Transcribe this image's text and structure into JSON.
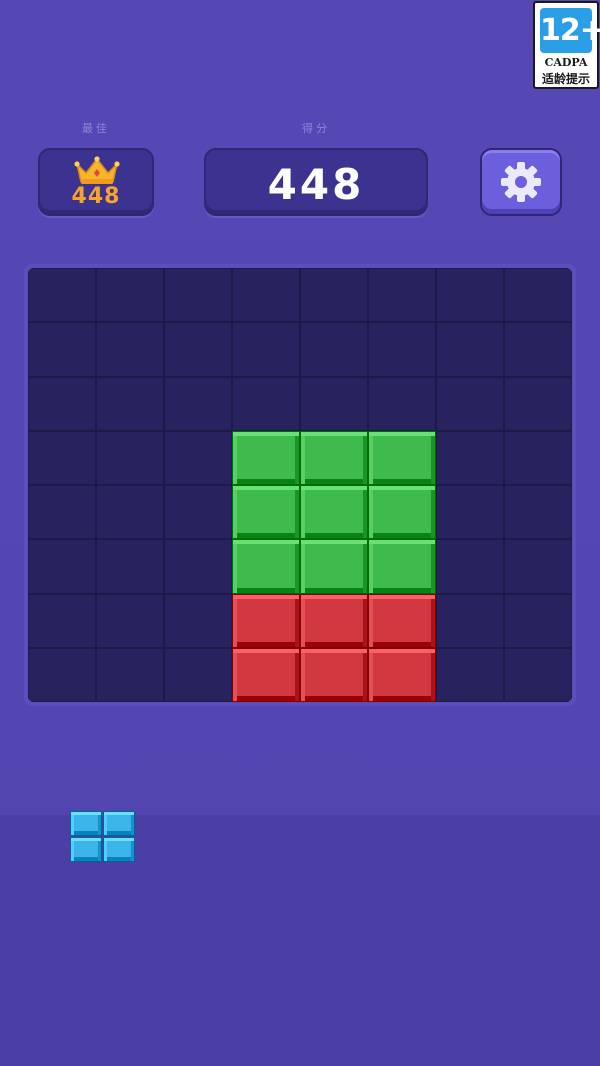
{
  "labels": {
    "best": "最佳",
    "score": "得分"
  },
  "best_score": "448",
  "current_score": "448",
  "age_rating": {
    "age": "12+",
    "org": "CADPA",
    "hint": "适龄提示"
  },
  "board": {
    "cols": 8,
    "rows": 8,
    "filled": [
      {
        "row": 3,
        "col": 3,
        "color": "green"
      },
      {
        "row": 3,
        "col": 4,
        "color": "green"
      },
      {
        "row": 3,
        "col": 5,
        "color": "green"
      },
      {
        "row": 4,
        "col": 3,
        "color": "green"
      },
      {
        "row": 4,
        "col": 4,
        "color": "green"
      },
      {
        "row": 4,
        "col": 5,
        "color": "green"
      },
      {
        "row": 5,
        "col": 3,
        "color": "green"
      },
      {
        "row": 5,
        "col": 4,
        "color": "green"
      },
      {
        "row": 5,
        "col": 5,
        "color": "green"
      },
      {
        "row": 6,
        "col": 3,
        "color": "red"
      },
      {
        "row": 6,
        "col": 4,
        "color": "red"
      },
      {
        "row": 6,
        "col": 5,
        "color": "red"
      },
      {
        "row": 7,
        "col": 3,
        "color": "red"
      },
      {
        "row": 7,
        "col": 4,
        "color": "red"
      },
      {
        "row": 7,
        "col": 5,
        "color": "red"
      }
    ]
  },
  "tray_piece": {
    "color": "blue",
    "cells": [
      [
        0,
        0
      ],
      [
        0,
        1
      ],
      [
        1,
        0
      ],
      [
        1,
        1
      ]
    ]
  },
  "colors": {
    "green": "#3fbb4d",
    "red": "#d2383f",
    "blue": "#3ab4ea",
    "accent": "#f6a42a"
  },
  "icons": {
    "best": "crown-icon",
    "settings": "gear-icon"
  }
}
